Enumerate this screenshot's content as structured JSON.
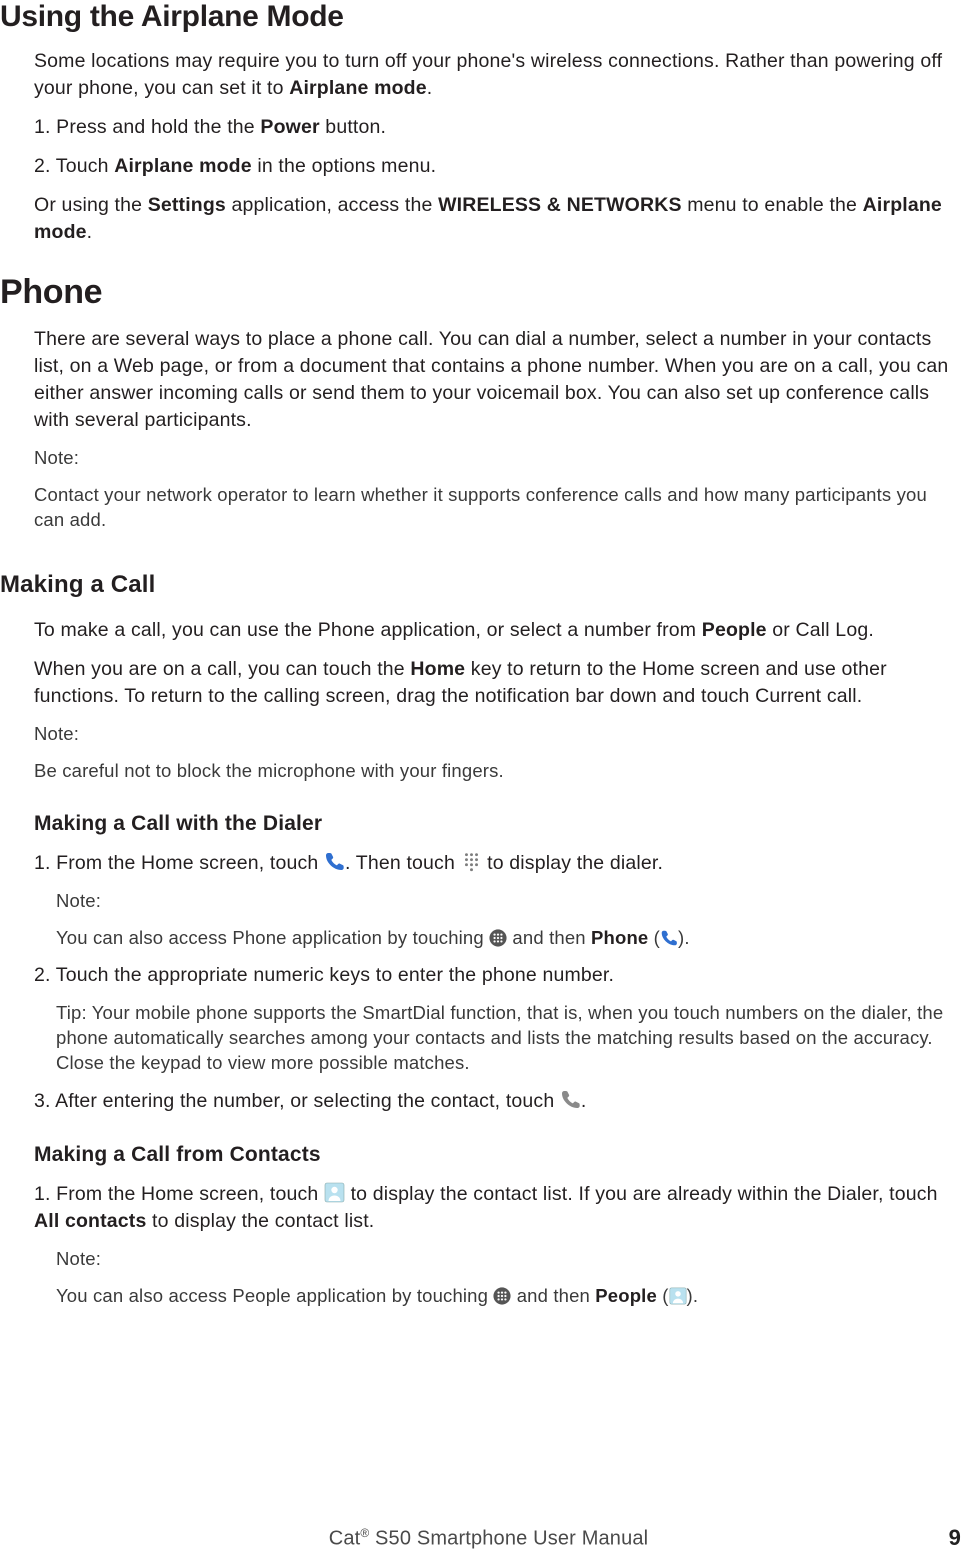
{
  "airplane": {
    "heading": "Using the Airplane Mode",
    "intro_pre": "Some locations may require you to turn off your phone's wireless connections. Rather than powering off your phone, you can set it to ",
    "intro_bold": "Airplane mode",
    "intro_post": ".",
    "step1_pre": "1. Press and hold the the ",
    "step1_bold": "Power",
    "step1_post": " button.",
    "step2_pre": "2. Touch ",
    "step2_bold": "Airplane mode",
    "step2_post": " in the options menu.",
    "alt_pre": "Or using the ",
    "alt_b1": "Settings",
    "alt_mid": " application, access the ",
    "alt_b2": "WIRELESS & NETWORKS",
    "alt_mid2": " menu to enable the ",
    "alt_b3": "Airplane mode",
    "alt_post": "."
  },
  "phone": {
    "heading": "Phone",
    "intro": "There are several ways to place a phone call. You can dial a number, select a number in your contacts list, on a Web page, or from a document that contains a phone number. When you are on a call, you can either answer incoming calls or send them to your voicemail box. You can also set up conference calls with several participants.",
    "note_label": "Note:",
    "note_body": "Contact your network operator to learn whether it supports conference calls and how many participants you can add."
  },
  "making_call": {
    "heading": "Making a Call",
    "p1_pre": "To make a call, you can use the Phone application, or select a number from ",
    "p1_bold": "People",
    "p1_post": " or Call Log.",
    "p2_pre": "When you are on a call, you can touch the ",
    "p2_bold": "Home",
    "p2_post": " key to return to the Home screen and use other functions. To return to the calling screen, drag the notification bar down and touch Current call.",
    "note_label": "Note:",
    "note_body": "Be careful not to block the microphone with your fingers."
  },
  "dialer": {
    "heading": "Making a Call with the Dialer",
    "s1_pre": "1. From the Home screen, touch ",
    "s1_mid": ". Then touch ",
    "s1_post": " to display the dialer.",
    "note_label": "Note:",
    "note_pre": "You can also access Phone application by touching ",
    "note_mid": " and then ",
    "note_bold": "Phone",
    "note_paren_open": " (",
    "note_paren_close": ").",
    "s2": "2. Touch the appropriate numeric keys to enter the phone number.",
    "tip": "Tip: Your mobile phone supports the SmartDial function, that is, when you touch numbers on the dialer, the phone automatically searches among your contacts and lists the matching results based on the accuracy. Close the keypad to view more possible matches.",
    "s3_pre": "3. After entering the number, or selecting the contact, touch ",
    "s3_post": "."
  },
  "contacts": {
    "heading": "Making a Call from Contacts",
    "s1_pre": "1. From the Home screen, touch ",
    "s1_mid": " to display the contact list. If you are already within the Dialer, touch ",
    "s1_bold": "All contacts",
    "s1_post": " to display the contact list.",
    "note_label": "Note:",
    "note_pre": "You can also access People application by touching ",
    "note_mid": " and then ",
    "note_bold": "People",
    "note_paren_open": " (",
    "note_paren_close": ")."
  },
  "footer": {
    "pre": "Cat",
    "reg": "®",
    "post": " S50 Smartphone User Manual",
    "page": "9"
  }
}
